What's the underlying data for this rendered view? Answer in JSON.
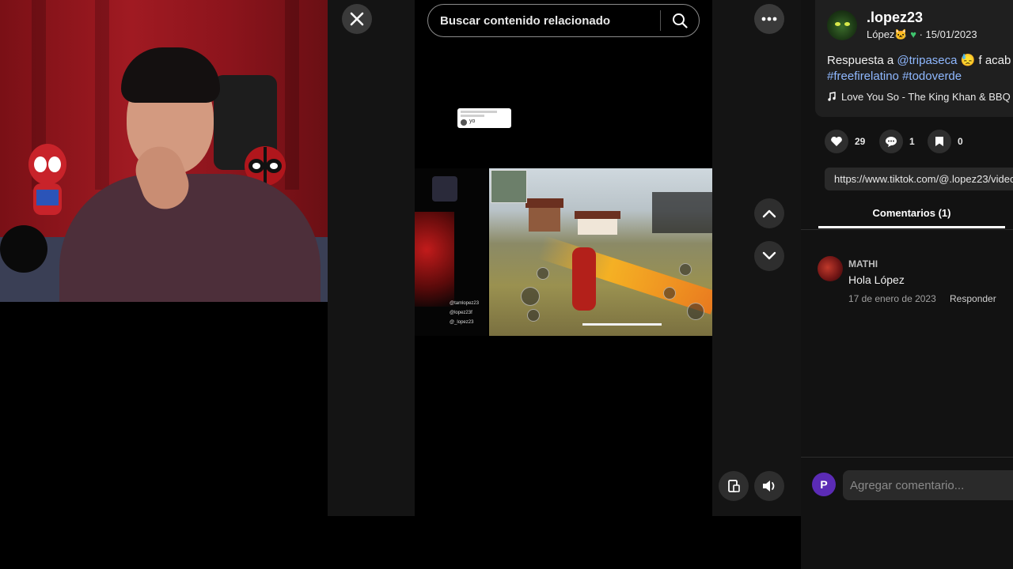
{
  "search": {
    "placeholder": "Buscar contenido relacionado"
  },
  "icons": {
    "close": "close-icon",
    "search": "search-icon",
    "more": "more-horizontal-icon",
    "up": "chevron-up-icon",
    "down": "chevron-down-icon",
    "report": "report-icon",
    "volume": "volume-icon",
    "like": "heart-icon",
    "comment": "comment-icon",
    "save": "bookmark-icon",
    "music": "music-note-icon"
  },
  "video": {
    "reply_bubble_text": "yo",
    "social_handles": [
      "@tamlopez23",
      "@lopez23f",
      "@_lopez23"
    ]
  },
  "author": {
    "username": ".lopez23",
    "display_name": "López",
    "date": "15/01/2023"
  },
  "description": {
    "prefix": "Respuesta a ",
    "mention": "@tripaseca",
    "suffix": " 😓 f acab",
    "hashtags": [
      "#freefirelatino",
      "#todoverde"
    ]
  },
  "music": {
    "title": "Love You So - The King Khan & BBQ"
  },
  "actions": {
    "likes": "29",
    "comments": "1",
    "saves": "0"
  },
  "link": {
    "url": "https://www.tiktok.com/@.lopez23/video"
  },
  "tabs": {
    "comments_label": "Comentarios (1)"
  },
  "comments": [
    {
      "user": "MATHI",
      "text": "Hola López",
      "date": "17 de enero de 2023",
      "reply_label": "Responder"
    }
  ],
  "composer": {
    "avatar_letter": "P",
    "placeholder": "Agregar comentario..."
  },
  "colors": {
    "accent_link": "#8fb8ff",
    "panel_bg": "#121212",
    "card_bg": "#1f1f1f",
    "avatar_purple": "#5b2bb5"
  }
}
